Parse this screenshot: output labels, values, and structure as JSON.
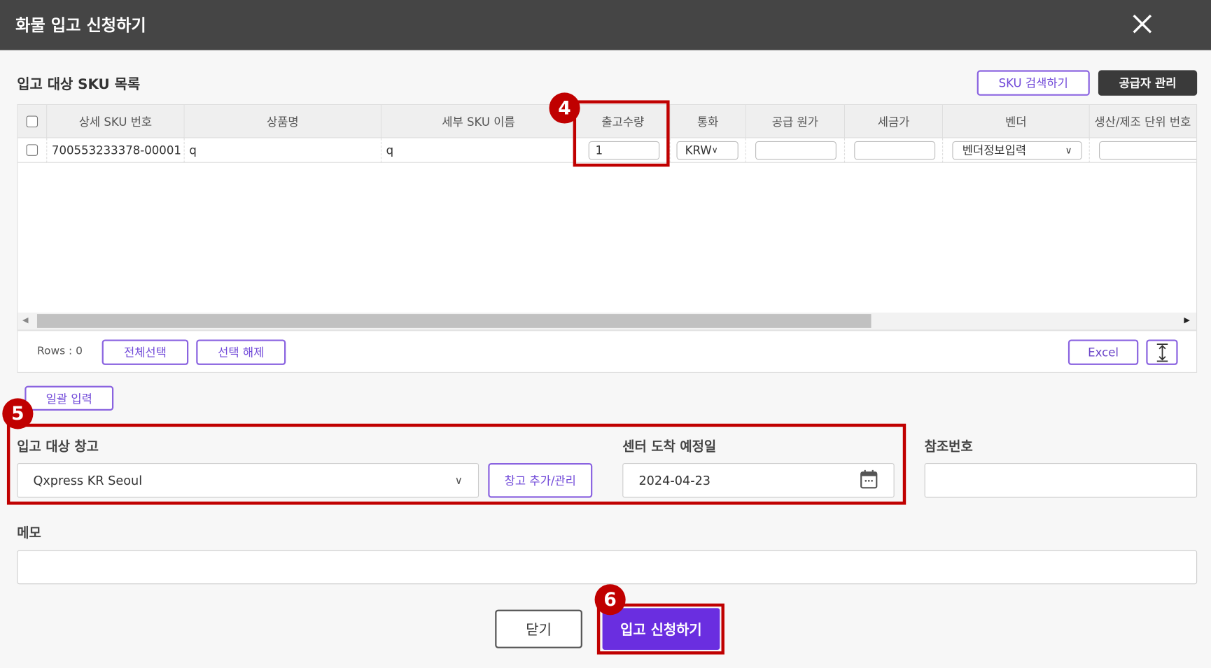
{
  "dialog": {
    "title": "화물 입고 신청하기"
  },
  "sku_section": {
    "title": "입고 대상 SKU 목록",
    "search_button": "SKU 검색하기",
    "supplier_button": "공급자 관리",
    "columns": [
      "상세 SKU 번호",
      "상품명",
      "세부 SKU 이름",
      "출고수량",
      "통화",
      "공급 원가",
      "세금가",
      "벤더",
      "생산/제조 단위 번호"
    ],
    "rows": [
      {
        "sku": "700553233378-00001",
        "product": "q",
        "sub_sku": "q",
        "qty": "1",
        "currency": "KRW",
        "supply_cost": "",
        "tax": "",
        "vendor": "벤더정보입력",
        "lot": ""
      }
    ],
    "scroll_fraction": 0.73,
    "rows_count": "Rows : 0",
    "select_all": "전체선택",
    "deselect": "선택 해제",
    "excel": "Excel"
  },
  "bulk_input": "일괄 입력",
  "warehouse": {
    "label": "입고 대상 창고",
    "value": "Qxpress KR Seoul",
    "manage_button": "창고 추가/관리"
  },
  "arrival": {
    "label": "센터 도착 예정일",
    "value": "2024-04-23"
  },
  "reference": {
    "label": "참조번호",
    "value": ""
  },
  "memo": {
    "label": "메모",
    "value": ""
  },
  "footer": {
    "close": "닫기",
    "submit": "입고 신청하기"
  },
  "annotations": [
    "4",
    "5",
    "6"
  ],
  "colors": {
    "accent": "#7048d8",
    "submit": "#6a2ee0",
    "annotation": "#c00000",
    "header": "#454545"
  }
}
